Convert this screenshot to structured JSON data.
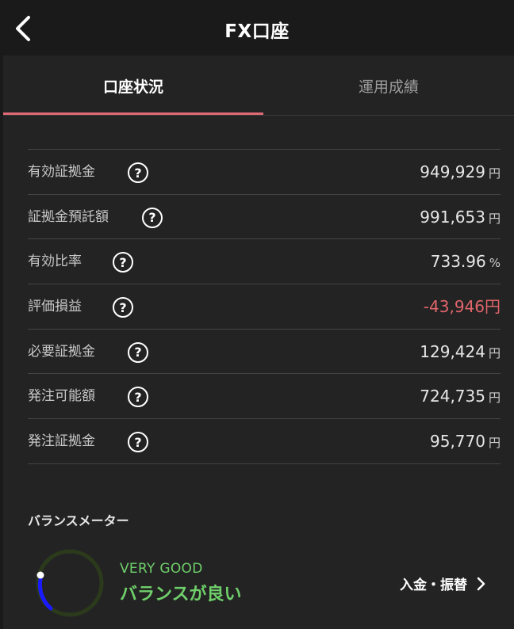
{
  "header": {
    "title": "FX口座"
  },
  "tabs": [
    {
      "label": "口座状況",
      "active": true
    },
    {
      "label": "運用成績",
      "active": false
    }
  ],
  "rows": [
    {
      "label": "有効証拠金",
      "value": "949,929",
      "unit": "円"
    },
    {
      "label": "証拠金預託額",
      "value": "991,653",
      "unit": "円"
    },
    {
      "label": "有効比率",
      "value": "733.96",
      "unit": "%"
    },
    {
      "label": "評価損益",
      "value": "-43,946",
      "unit": "円",
      "negative": true
    },
    {
      "label": "必要証拠金",
      "value": "129,424",
      "unit": "円"
    },
    {
      "label": "発注可能額",
      "value": "724,735",
      "unit": "円"
    },
    {
      "label": "発注証拠金",
      "value": "95,770",
      "unit": "円"
    }
  ],
  "help_glyph": "?",
  "balance_meter": {
    "title": "バランスメーター",
    "status_en": "VERY GOOD",
    "status_jp": "バランスが良い",
    "status_color": "#6fcf6a",
    "link_label": "入金・振替"
  },
  "colors": {
    "accent": "#e06a76",
    "negative": "#e0656a",
    "good": "#6fcf6a",
    "meter_blue": "#1a1aff"
  },
  "icons": {
    "back": "chevron-left-icon",
    "help": "question-circle-icon",
    "link": "chevron-right-icon"
  }
}
